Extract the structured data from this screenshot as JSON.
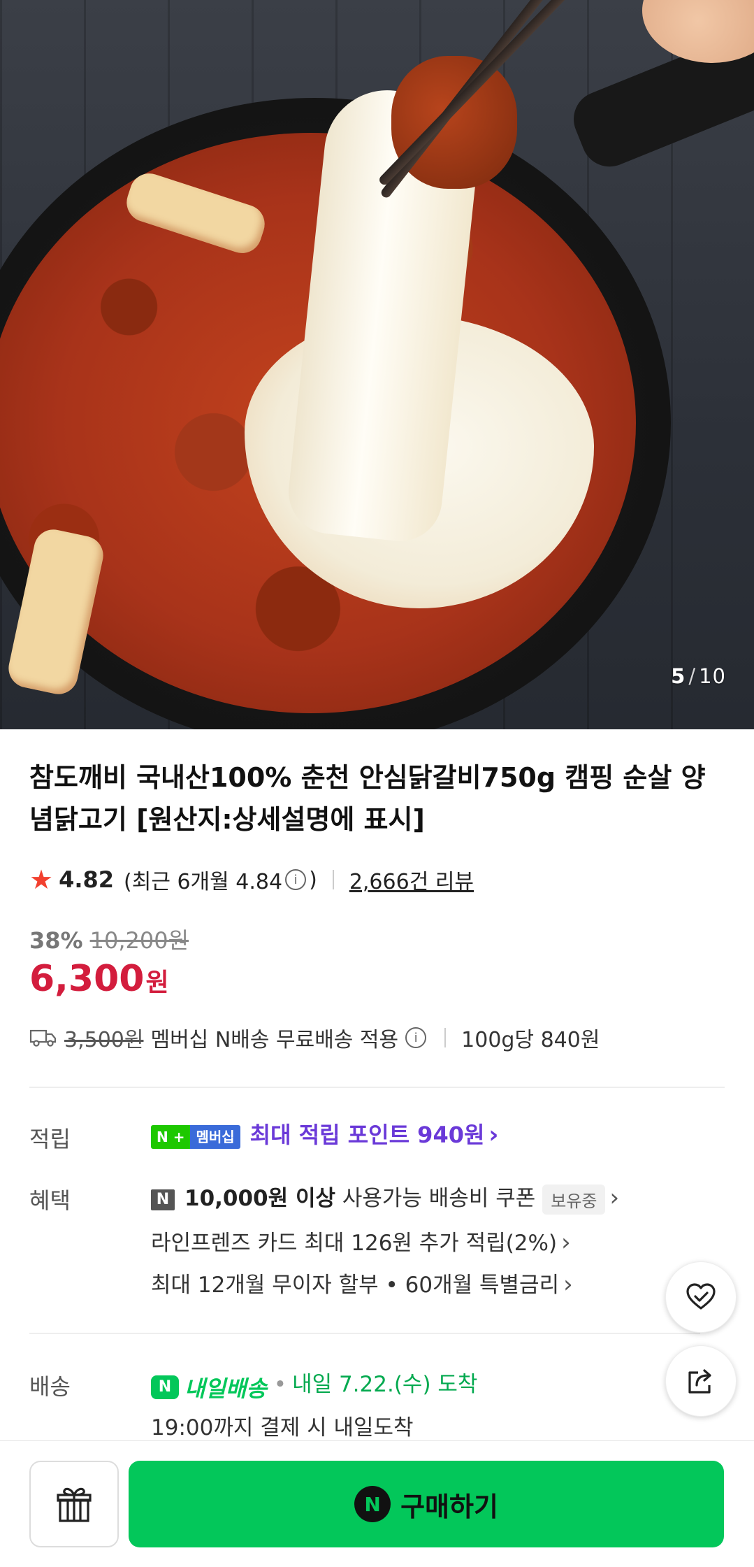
{
  "gallery": {
    "current": "5",
    "separator": "/",
    "total": "10"
  },
  "product": {
    "title": "참도깨비 국내산100% 춘천 안심닭갈비750g 캠핑 순살 양념닭고기 [원산지:상세설명에 표시]",
    "rating": "4.82",
    "recent_rating_prefix": "(최근 6개월 4.84",
    "recent_rating_suffix": ")",
    "review_count": "2,666건 리뷰",
    "discount_rate": "38%",
    "original_price": "10,200원",
    "price": "6,300",
    "price_unit": "원",
    "shipping_original": "3,500원",
    "shipping_text": "멤버십 N배송 무료배송 적용",
    "unit_price": "100g당 840원"
  },
  "points": {
    "label": "적립",
    "badge_plus": "N +",
    "badge_membership": "멤버십",
    "text": "최대 적립 포인트 940원"
  },
  "benefits": {
    "label": "혜택",
    "coupon_bold": "10,000원 이상",
    "coupon_text": "사용가능 배송비 쿠폰",
    "owned_badge": "보유중",
    "card_text": "라인프렌즈 카드 최대 126원 추가 적립(2%)",
    "installment_text": "최대 12개월 무이자 할부 • 60개월 특별금리"
  },
  "delivery": {
    "label": "배송",
    "badge_text": "내일배송",
    "date_text": "내일 7.22.(수) 도착",
    "cutoff_text": "19:00까지 결제 시 내일도착"
  },
  "bottom": {
    "buy_label": "구매하기"
  },
  "icons": {
    "star": "star-icon",
    "gift": "gift-icon",
    "share": "share-icon",
    "wishlist": "heart-check-icon",
    "truck": "truck-icon"
  },
  "colors": {
    "price_red": "#d31d3d",
    "naver_green": "#03c75a",
    "points_purple": "#6a39d8",
    "star_red": "#f2402f"
  }
}
